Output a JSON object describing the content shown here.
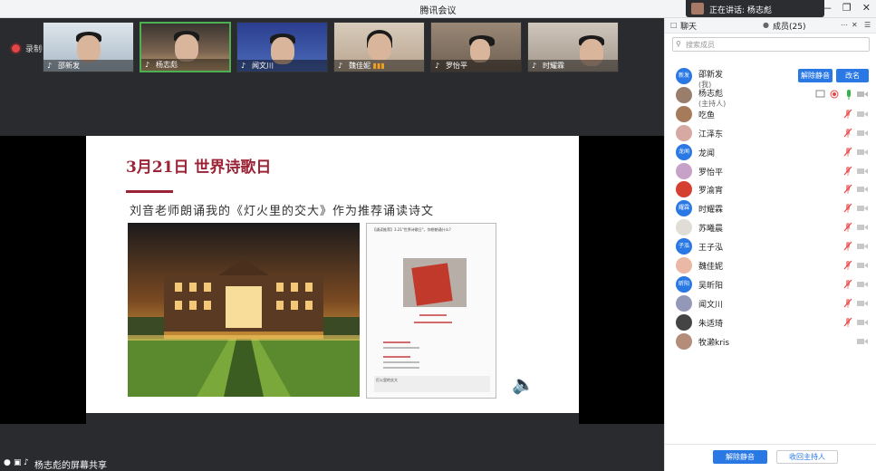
{
  "window": {
    "title": "腾讯会议",
    "speaking_label": "正在讲话: 杨志彪"
  },
  "recording": {
    "label": "录制中"
  },
  "video_tiles": [
    {
      "name": "邵新发",
      "active": false,
      "bg": "#b8c8d6"
    },
    {
      "name": "杨志彪",
      "active": true,
      "bg": "#6c5a4a"
    },
    {
      "name": "闻文川",
      "active": false,
      "bg": "#3a4a8a"
    },
    {
      "name": "魏佳妮",
      "active": false,
      "bg": "#c9b8a4"
    },
    {
      "name": "罗怡平",
      "active": false,
      "bg": "#8a7a6a"
    },
    {
      "name": "时耀霖",
      "active": false,
      "bg": "#b6aa9c"
    }
  ],
  "slide": {
    "title": "3月21日  世界诗歌日",
    "subtitle": "刘音老师朗诵我的《灯火里的交大》作为推荐诵读诗文",
    "doc_header": "【诵读推荐】3.21\"世界诗歌日\"，你想朗诵什么?",
    "doc_footer": "灯火里的交大"
  },
  "screen_share": {
    "label": "杨志彪的屏幕共享"
  },
  "panel": {
    "tab_chat": "聊天",
    "tab_members": "成员(25)",
    "search_placeholder": "搜索成员",
    "unmute_button": "解除静音",
    "rename_button": "改名",
    "members": [
      {
        "name": "邵新发",
        "role": "(我)",
        "avatar_text": "新发",
        "avatar_color": "#2a78e4"
      },
      {
        "name": "杨志彪",
        "role": "(主持人)",
        "avatar_text": "",
        "avatar_color": "#9a7e6c"
      },
      {
        "name": "吃鱼",
        "role": "",
        "avatar_text": "",
        "avatar_color": "#a67b5b"
      },
      {
        "name": "江泽东",
        "role": "",
        "avatar_text": "",
        "avatar_color": "#d7a9a3"
      },
      {
        "name": "龙闻",
        "role": "",
        "avatar_text": "龙闻",
        "avatar_color": "#2a78e4"
      },
      {
        "name": "罗怡平",
        "role": "",
        "avatar_text": "",
        "avatar_color": "#c8a1c8"
      },
      {
        "name": "罗渝宵",
        "role": "",
        "avatar_text": "",
        "avatar_color": "#d64030"
      },
      {
        "name": "时耀霖",
        "role": "",
        "avatar_text": "耀霖",
        "avatar_color": "#2a78e4"
      },
      {
        "name": "苏曦晨",
        "role": "",
        "avatar_text": "",
        "avatar_color": "#e0ddd6"
      },
      {
        "name": "王子泓",
        "role": "",
        "avatar_text": "子泓",
        "avatar_color": "#2a78e4"
      },
      {
        "name": "魏佳妮",
        "role": "",
        "avatar_text": "",
        "avatar_color": "#eab8a4"
      },
      {
        "name": "吴昕阳",
        "role": "",
        "avatar_text": "昕阳",
        "avatar_color": "#2a78e4"
      },
      {
        "name": "闻文川",
        "role": "",
        "avatar_text": "",
        "avatar_color": "#9498b8"
      },
      {
        "name": "朱适琦",
        "role": "",
        "avatar_text": "",
        "avatar_color": "#444"
      },
      {
        "name": "牧濑kris",
        "role": "",
        "avatar_text": "",
        "avatar_color": "#b48c7a"
      }
    ],
    "footer_unmute": "解除静音",
    "footer_reclaim_host": "收回主持人"
  }
}
